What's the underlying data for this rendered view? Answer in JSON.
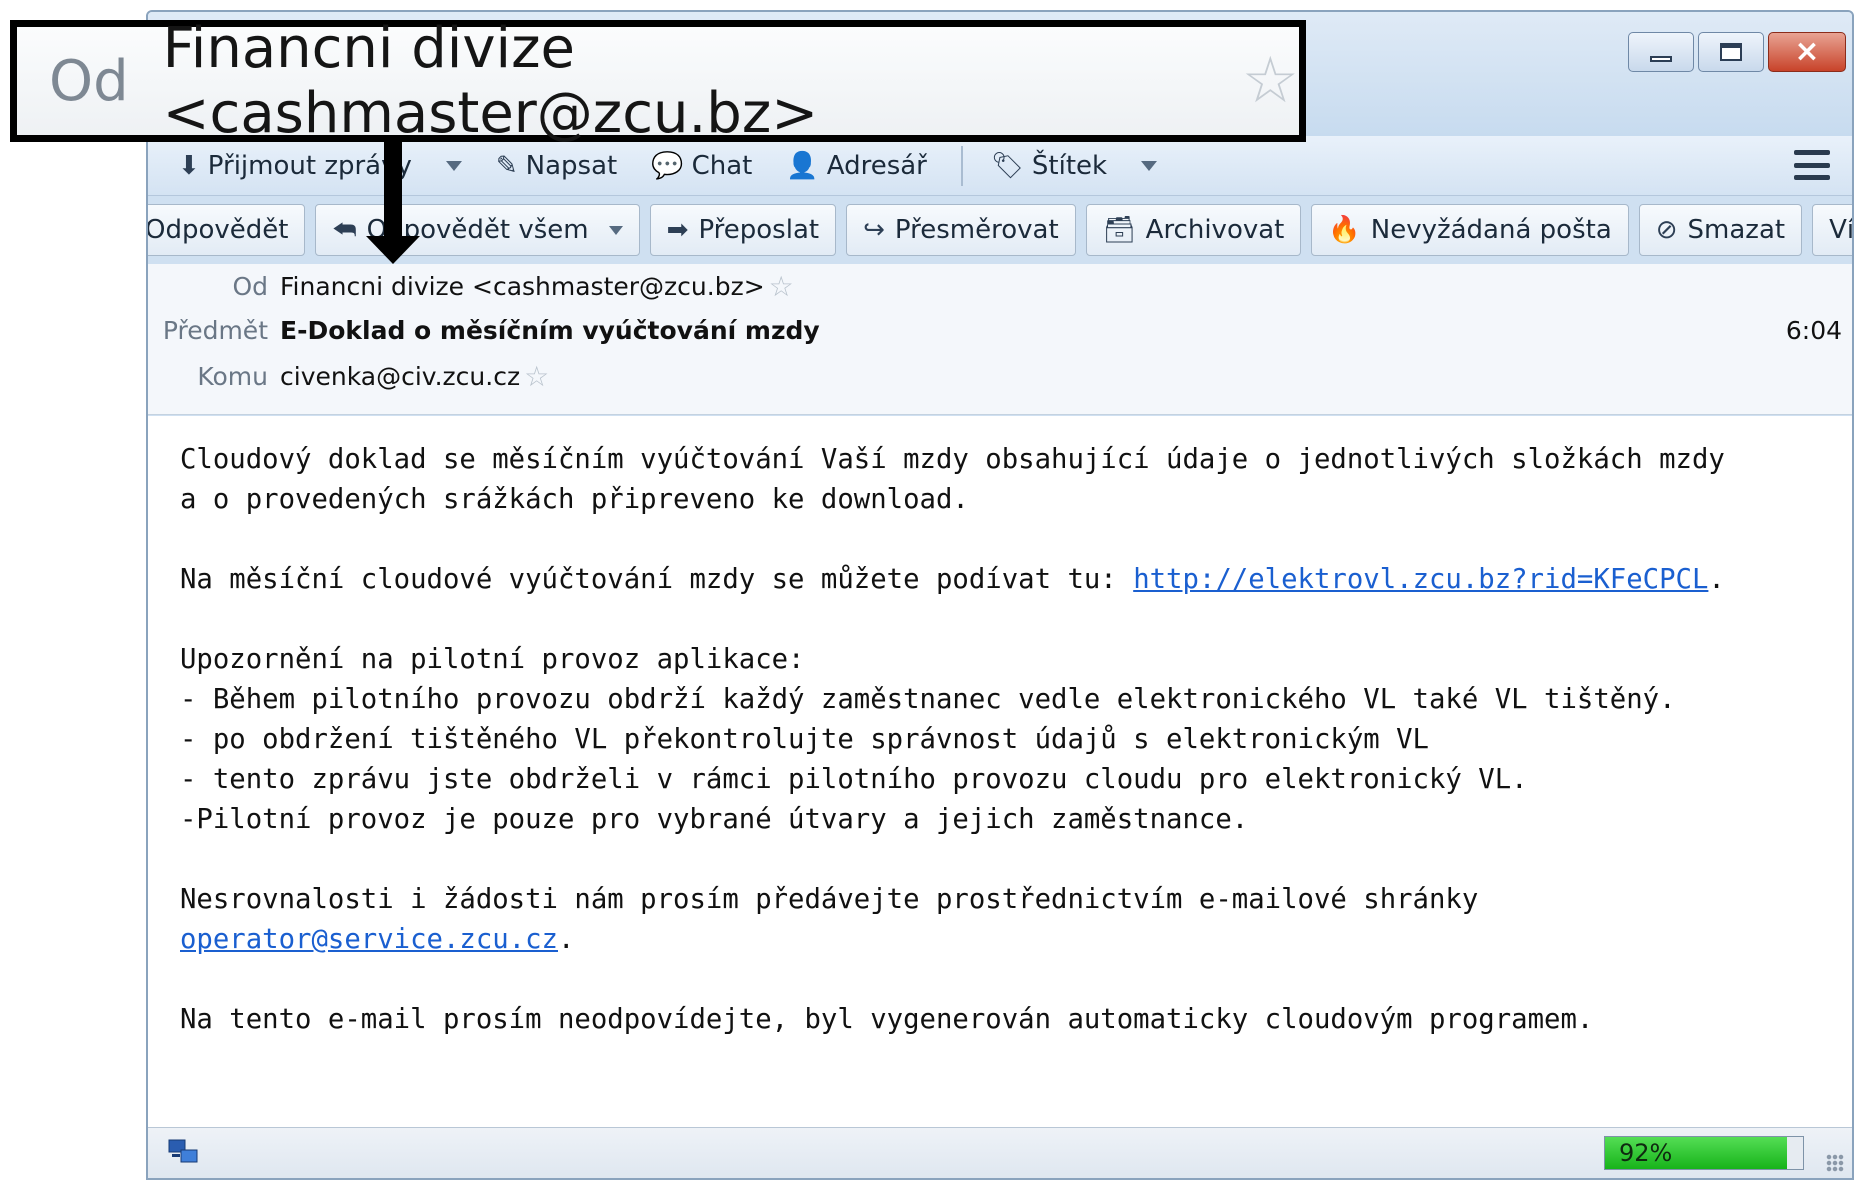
{
  "window": {
    "controls": {
      "minimize": "minimize",
      "maximize": "maximize",
      "close": "×"
    }
  },
  "toolbar": {
    "receive": "Přijmout zprávy",
    "write": "Napsat",
    "chat": "Chat",
    "address_book": "Adresář",
    "tag": "Štítek"
  },
  "actions": {
    "reply": "Odpovědět",
    "reply_all": "Odpovědět všem",
    "forward": "Přeposlat",
    "redirect": "Přesměrovat",
    "archive": "Archivovat",
    "junk": "Nevyžádaná pošta",
    "delete": "Smazat",
    "more": "Více"
  },
  "header": {
    "from_label": "Od",
    "from_value": "Financni divize <cashmaster@zcu.bz>",
    "subject_label": "Předmět",
    "subject_value": "E-Doklad o měsíčním vyúčtování mzdy",
    "time": "6:04",
    "to_label": "Komu",
    "to_value": "civenka@civ.zcu.cz"
  },
  "body": {
    "p1_line1": "Cloudový doklad se měsíčním vyúčtování Vaší mzdy obsahující údaje o jednotlivých složkách mzdy",
    "p1_line2": "a o provedených srážkách připreveno ke download.",
    "p2_text": "Na měsíční cloudové vyúčtování mzdy se můžete podívat tu: ",
    "p2_link": "http://elektrovl.zcu.bz?rid=KFeCPCL",
    "p2_end": ".",
    "p3_title": "Upozornění na pilotní provoz aplikace:",
    "p3_line1": "- Během pilotního provozu obdrží každý zaměstnanec vedle elektronického VL také VL tištěný.",
    "p3_line2": "- po obdržení tištěného VL překontrolujte správnost údajů s elektronickým VL",
    "p3_line3": "- tento zprávu jste obdrželi v rámci pilotního provozu cloudu pro elektronický VL.",
    "p3_line4": "-Pilotní provoz je pouze pro vybrané útvary a jejich zaměstnance.",
    "p4_line1": "Nesrovnalosti i žádosti nám prosím předávejte prostřednictvím e-mailové shránky",
    "p4_link": "operator@service.zcu.cz",
    "p4_end": ".",
    "p5": "Na tento e-mail prosím neodpovídejte, byl vygenerován automaticky cloudovým programem."
  },
  "status": {
    "progress_text": "92%",
    "progress_value": 0.92
  },
  "callout": {
    "label": "Od",
    "value": "Financni divize <cashmaster@zcu.bz>"
  },
  "colors": {
    "link": "#1a5fd0",
    "progress": "#17b31a",
    "callout_border": "#000000"
  }
}
